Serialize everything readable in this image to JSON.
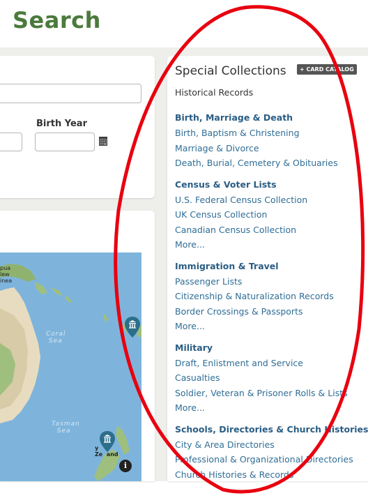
{
  "page": {
    "title": "Search"
  },
  "form": {
    "birth_year_label": "Birth Year",
    "name_value": "",
    "date_value": "",
    "year_value": ""
  },
  "map": {
    "labels": {
      "coral_sea": "Coral\nSea",
      "tasman_sea": "Tasman\nSea",
      "papua": "pua\nlew\ninea",
      "new_zealand_fragment": "y\nZe  and"
    },
    "info_icon": "info-icon"
  },
  "special": {
    "title": "Special Collections",
    "card_catalog_label": "+ CARD CATALOG",
    "subtitle": "Historical Records",
    "groups": [
      {
        "heading": "Birth, Marriage & Death",
        "items": [
          "Birth, Baptism & Christening",
          "Marriage & Divorce",
          "Death, Burial, Cemetery & Obituaries"
        ]
      },
      {
        "heading": "Census & Voter Lists",
        "items": [
          "U.S. Federal Census Collection",
          "UK Census Collection",
          "Canadian Census Collection",
          "More..."
        ]
      },
      {
        "heading": "Immigration & Travel",
        "items": [
          "Passenger Lists",
          "Citizenship & Naturalization Records",
          "Border Crossings & Passports",
          "More..."
        ]
      },
      {
        "heading": "Military",
        "items": [
          "Draft, Enlistment and Service",
          "Casualties",
          "Soldier, Veteran & Prisoner Rolls & Lists",
          "More..."
        ]
      },
      {
        "heading": "Schools, Directories & Church Histories",
        "items": [
          "City & Area Directories",
          "Professional & Organizational Directories",
          "Church Histories & Records"
        ]
      }
    ]
  },
  "colors": {
    "title_green": "#4b7a3c",
    "link_blue": "#2f6d95",
    "heading_blue": "#2a5d84",
    "annotation_red": "#e8000f"
  }
}
